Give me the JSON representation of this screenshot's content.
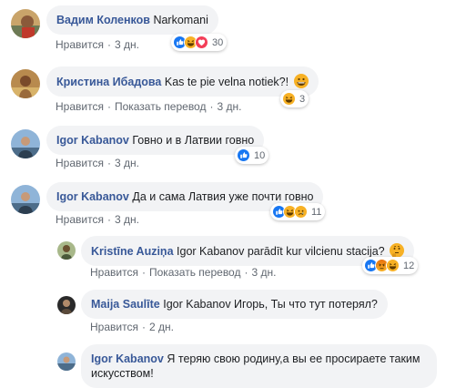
{
  "comments": [
    {
      "author": "Вадим Коленков",
      "text": "Narkomani",
      "actions": {
        "like": "Нравится",
        "time": "3 дн."
      },
      "reactions": {
        "icons": [
          "like-icon",
          "haha-icon",
          "love-icon"
        ],
        "count": "30"
      }
    },
    {
      "author": "Кристина Ибадова",
      "text": "Kas te pie velna notiek?!",
      "emoji": "grin-emoji",
      "actions": {
        "like": "Нравится",
        "translate": "Показать перевод",
        "time": "3 дн."
      },
      "reactions": {
        "icons": [
          "haha-icon"
        ],
        "count": "3"
      }
    },
    {
      "author": "Igor Kabanov",
      "text": "Говно и в Латвии говно",
      "actions": {
        "like": "Нравится",
        "time": "3 дн."
      },
      "reactions": {
        "icons": [
          "like-icon"
        ],
        "count": "10"
      }
    },
    {
      "author": "Igor Kabanov",
      "text": "Да и сама Латвия уже почти говно",
      "actions": {
        "like": "Нравится",
        "time": "3 дн."
      },
      "reactions": {
        "icons": [
          "like-icon",
          "haha-icon",
          "sad-icon"
        ],
        "count": "11"
      }
    }
  ],
  "replies": [
    {
      "author": "Kristīne Auziņa",
      "text": "Igor Kabanov parādīt kur vilcienu stacija?",
      "emoji": "thinking-emoji",
      "actions": {
        "like": "Нравится",
        "translate": "Показать перевод",
        "time": "3 дн."
      },
      "reactions": {
        "icons": [
          "like-icon",
          "angry-icon",
          "haha-icon"
        ],
        "count": "12"
      }
    },
    {
      "author": "Maija Saulīte",
      "text": "Igor Kabanov Игорь, Ты что тут потерял?",
      "actions": {
        "like": "Нравится",
        "time": "2 дн."
      }
    },
    {
      "author": "Igor Kabanov",
      "text": "Я теряю свою родину,а вы ее просираете таким искусством!"
    }
  ],
  "colors": {
    "author": "#385898",
    "bubble": "#f2f3f5",
    "meta": "#606770",
    "like_blue": "#1877f2",
    "love_red": "#f33e58",
    "emoji_yellow": "#f7b125"
  }
}
